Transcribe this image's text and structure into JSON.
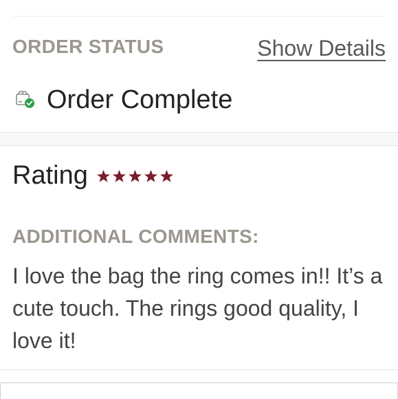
{
  "order_status": {
    "label": "ORDER STATUS",
    "show_details_label": "Show Details",
    "status_text": "Order Complete",
    "status_icon": "box-check-icon",
    "status_color": "#2e9e4b"
  },
  "rating": {
    "label": "Rating",
    "stars": 5,
    "max_stars": 5,
    "star_color": "#7a1e2c"
  },
  "comments": {
    "label": "ADDITIONAL COMMENTS:",
    "text": "I love the bag the ring comes in!! It’s a cute touch. The rings good quality, I love it!"
  }
}
